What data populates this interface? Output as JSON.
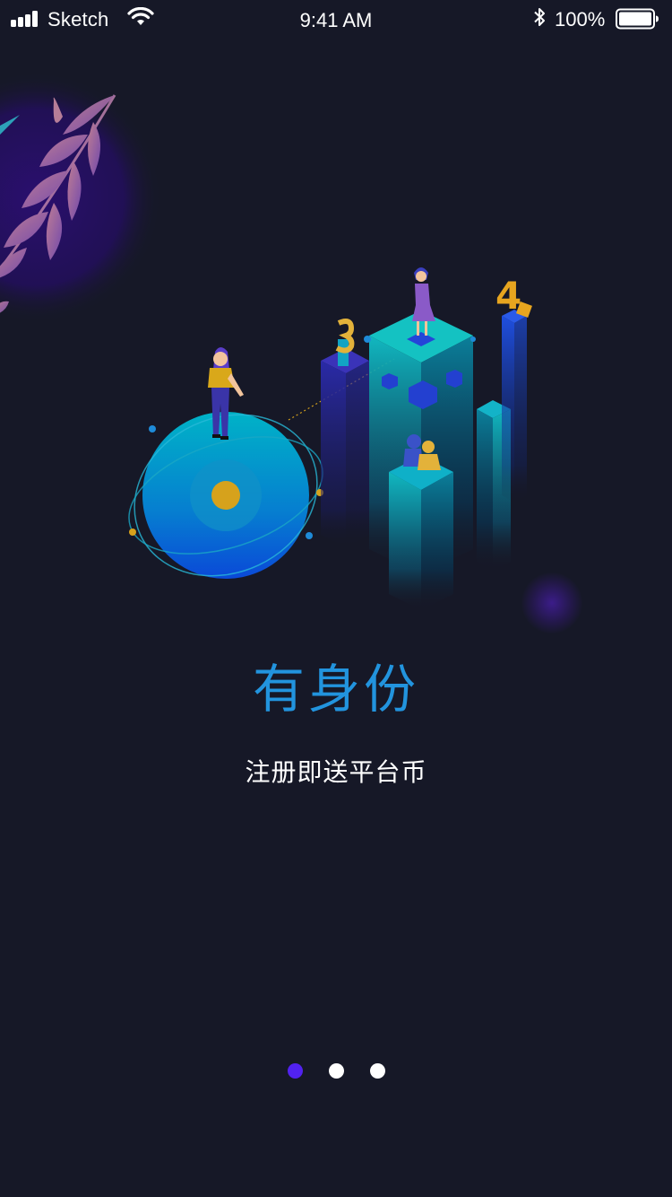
{
  "status_bar": {
    "carrier": "Sketch",
    "time": "9:41 AM",
    "battery_percent": "100%",
    "icons": [
      "signal-icon",
      "wifi-icon",
      "bluetooth-icon",
      "battery-icon"
    ]
  },
  "onboarding": {
    "title": "有身份",
    "subtitle": "注册即送平台币",
    "illustration_numbers": [
      "3",
      "4"
    ],
    "current_page": 1,
    "total_pages": 3
  },
  "colors": {
    "background": "#161827",
    "title": "#2294de",
    "subtitle": "#ffffff",
    "active_dot": "#5222f0",
    "inactive_dot": "#ffffff"
  }
}
